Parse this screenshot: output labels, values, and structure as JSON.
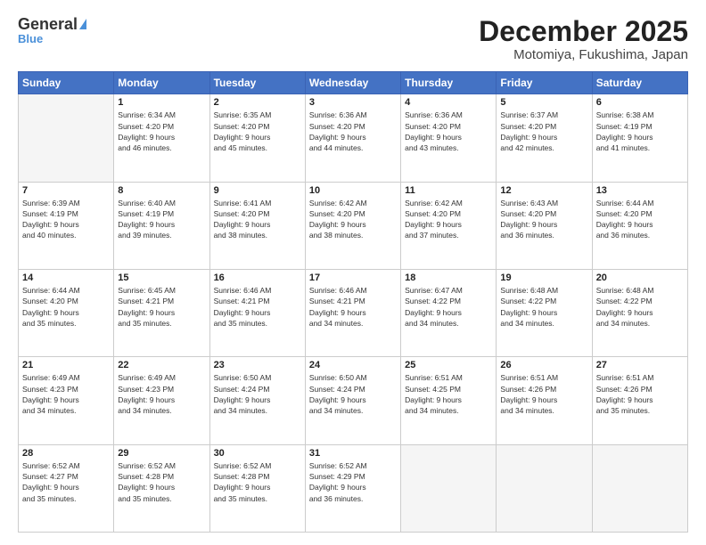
{
  "header": {
    "logo_line1": "General",
    "logo_line2": "Blue",
    "month": "December 2025",
    "location": "Motomiya, Fukushima, Japan"
  },
  "weekdays": [
    "Sunday",
    "Monday",
    "Tuesday",
    "Wednesday",
    "Thursday",
    "Friday",
    "Saturday"
  ],
  "weeks": [
    [
      {
        "day": "",
        "info": ""
      },
      {
        "day": "1",
        "info": "Sunrise: 6:34 AM\nSunset: 4:20 PM\nDaylight: 9 hours\nand 46 minutes."
      },
      {
        "day": "2",
        "info": "Sunrise: 6:35 AM\nSunset: 4:20 PM\nDaylight: 9 hours\nand 45 minutes."
      },
      {
        "day": "3",
        "info": "Sunrise: 6:36 AM\nSunset: 4:20 PM\nDaylight: 9 hours\nand 44 minutes."
      },
      {
        "day": "4",
        "info": "Sunrise: 6:36 AM\nSunset: 4:20 PM\nDaylight: 9 hours\nand 43 minutes."
      },
      {
        "day": "5",
        "info": "Sunrise: 6:37 AM\nSunset: 4:20 PM\nDaylight: 9 hours\nand 42 minutes."
      },
      {
        "day": "6",
        "info": "Sunrise: 6:38 AM\nSunset: 4:19 PM\nDaylight: 9 hours\nand 41 minutes."
      }
    ],
    [
      {
        "day": "7",
        "info": "Sunrise: 6:39 AM\nSunset: 4:19 PM\nDaylight: 9 hours\nand 40 minutes."
      },
      {
        "day": "8",
        "info": "Sunrise: 6:40 AM\nSunset: 4:19 PM\nDaylight: 9 hours\nand 39 minutes."
      },
      {
        "day": "9",
        "info": "Sunrise: 6:41 AM\nSunset: 4:20 PM\nDaylight: 9 hours\nand 38 minutes."
      },
      {
        "day": "10",
        "info": "Sunrise: 6:42 AM\nSunset: 4:20 PM\nDaylight: 9 hours\nand 38 minutes."
      },
      {
        "day": "11",
        "info": "Sunrise: 6:42 AM\nSunset: 4:20 PM\nDaylight: 9 hours\nand 37 minutes."
      },
      {
        "day": "12",
        "info": "Sunrise: 6:43 AM\nSunset: 4:20 PM\nDaylight: 9 hours\nand 36 minutes."
      },
      {
        "day": "13",
        "info": "Sunrise: 6:44 AM\nSunset: 4:20 PM\nDaylight: 9 hours\nand 36 minutes."
      }
    ],
    [
      {
        "day": "14",
        "info": "Sunrise: 6:44 AM\nSunset: 4:20 PM\nDaylight: 9 hours\nand 35 minutes."
      },
      {
        "day": "15",
        "info": "Sunrise: 6:45 AM\nSunset: 4:21 PM\nDaylight: 9 hours\nand 35 minutes."
      },
      {
        "day": "16",
        "info": "Sunrise: 6:46 AM\nSunset: 4:21 PM\nDaylight: 9 hours\nand 35 minutes."
      },
      {
        "day": "17",
        "info": "Sunrise: 6:46 AM\nSunset: 4:21 PM\nDaylight: 9 hours\nand 34 minutes."
      },
      {
        "day": "18",
        "info": "Sunrise: 6:47 AM\nSunset: 4:22 PM\nDaylight: 9 hours\nand 34 minutes."
      },
      {
        "day": "19",
        "info": "Sunrise: 6:48 AM\nSunset: 4:22 PM\nDaylight: 9 hours\nand 34 minutes."
      },
      {
        "day": "20",
        "info": "Sunrise: 6:48 AM\nSunset: 4:22 PM\nDaylight: 9 hours\nand 34 minutes."
      }
    ],
    [
      {
        "day": "21",
        "info": "Sunrise: 6:49 AM\nSunset: 4:23 PM\nDaylight: 9 hours\nand 34 minutes."
      },
      {
        "day": "22",
        "info": "Sunrise: 6:49 AM\nSunset: 4:23 PM\nDaylight: 9 hours\nand 34 minutes."
      },
      {
        "day": "23",
        "info": "Sunrise: 6:50 AM\nSunset: 4:24 PM\nDaylight: 9 hours\nand 34 minutes."
      },
      {
        "day": "24",
        "info": "Sunrise: 6:50 AM\nSunset: 4:24 PM\nDaylight: 9 hours\nand 34 minutes."
      },
      {
        "day": "25",
        "info": "Sunrise: 6:51 AM\nSunset: 4:25 PM\nDaylight: 9 hours\nand 34 minutes."
      },
      {
        "day": "26",
        "info": "Sunrise: 6:51 AM\nSunset: 4:26 PM\nDaylight: 9 hours\nand 34 minutes."
      },
      {
        "day": "27",
        "info": "Sunrise: 6:51 AM\nSunset: 4:26 PM\nDaylight: 9 hours\nand 35 minutes."
      }
    ],
    [
      {
        "day": "28",
        "info": "Sunrise: 6:52 AM\nSunset: 4:27 PM\nDaylight: 9 hours\nand 35 minutes."
      },
      {
        "day": "29",
        "info": "Sunrise: 6:52 AM\nSunset: 4:28 PM\nDaylight: 9 hours\nand 35 minutes."
      },
      {
        "day": "30",
        "info": "Sunrise: 6:52 AM\nSunset: 4:28 PM\nDaylight: 9 hours\nand 35 minutes."
      },
      {
        "day": "31",
        "info": "Sunrise: 6:52 AM\nSunset: 4:29 PM\nDaylight: 9 hours\nand 36 minutes."
      },
      {
        "day": "",
        "info": ""
      },
      {
        "day": "",
        "info": ""
      },
      {
        "day": "",
        "info": ""
      }
    ]
  ]
}
